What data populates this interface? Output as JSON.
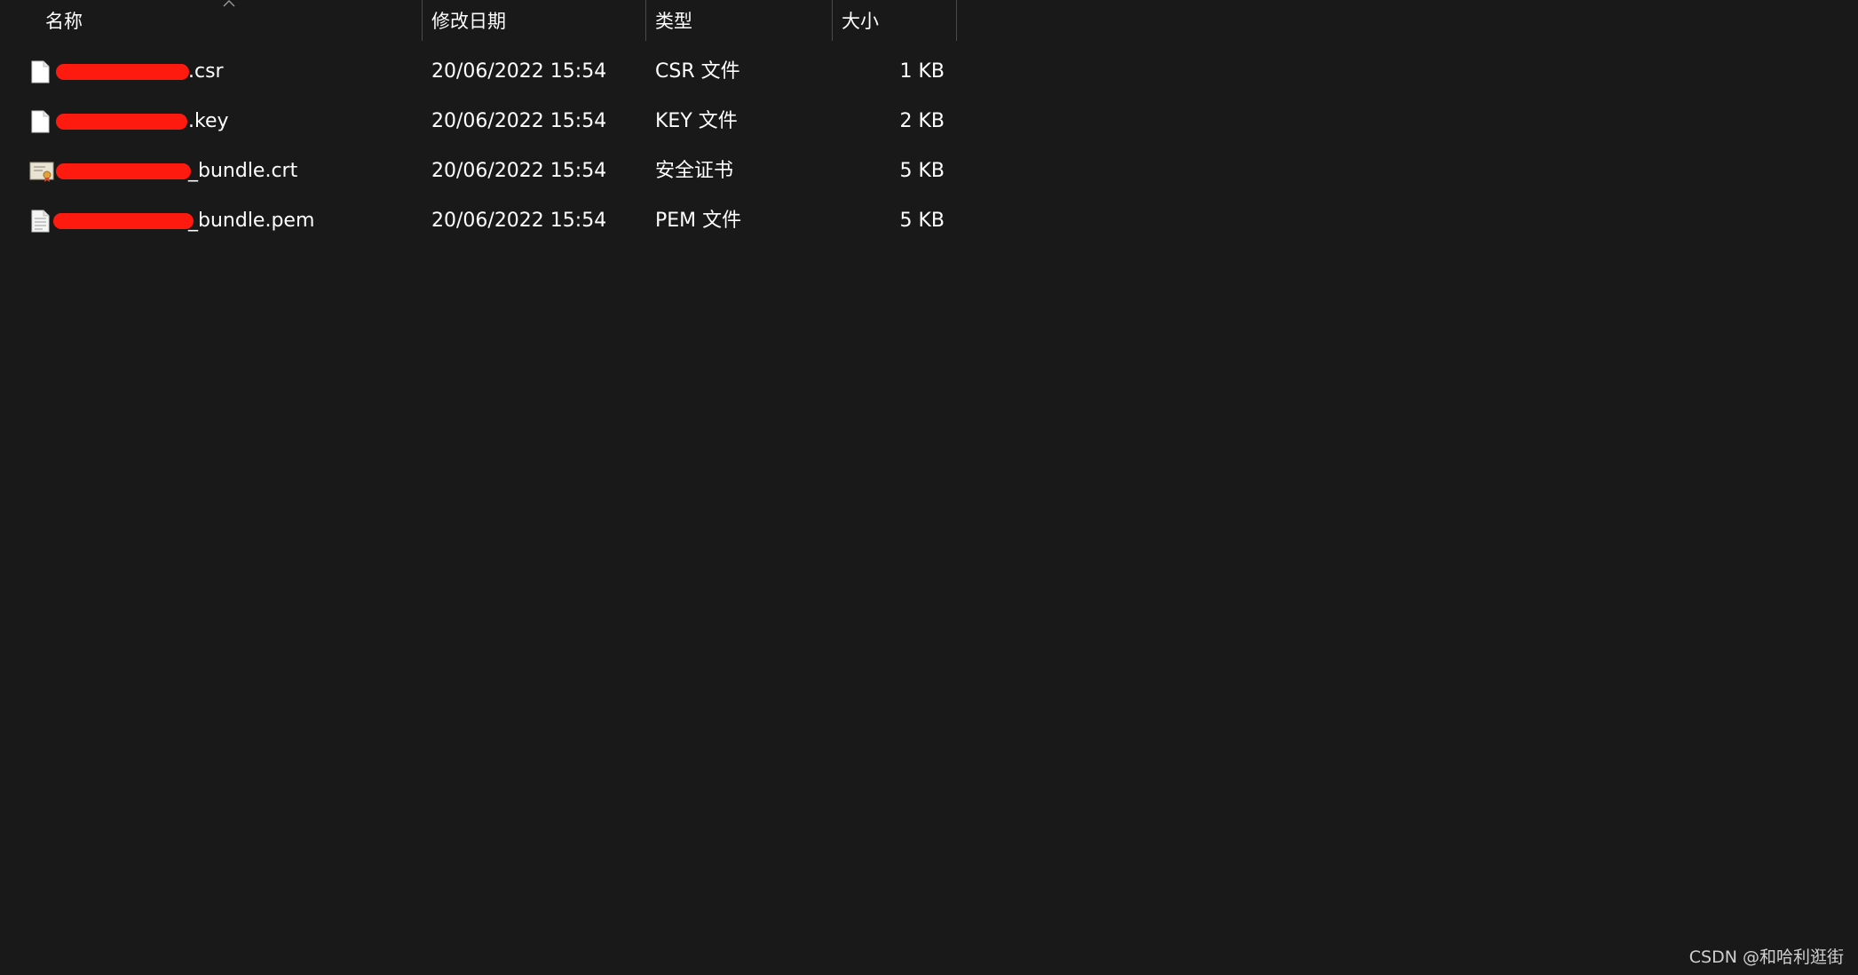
{
  "columns": {
    "name": "名称",
    "date": "修改日期",
    "type": "类型",
    "size": "大小"
  },
  "sort": {
    "column": "name",
    "icon": "chevron-up-icon"
  },
  "files": [
    {
      "name_suffix": ".csr",
      "date": "20/06/2022 15:54",
      "type": "CSR 文件",
      "size": "1 KB",
      "icon": "blank-file-icon"
    },
    {
      "name_suffix": ".key",
      "date": "20/06/2022 15:54",
      "type": "KEY 文件",
      "size": "2 KB",
      "icon": "blank-file-icon"
    },
    {
      "name_suffix": "_bundle.crt",
      "date": "20/06/2022 15:54",
      "type": "安全证书",
      "size": "5 KB",
      "icon": "certificate-icon"
    },
    {
      "name_suffix": "_bundle.pem",
      "date": "20/06/2022 15:54",
      "type": "PEM 文件",
      "size": "5 KB",
      "icon": "text-file-icon"
    }
  ],
  "watermark": "CSDN @和哈利逛街",
  "colors": {
    "background": "#191919",
    "text": "#ffffff",
    "redaction": "#ff1a0f",
    "divider": "#4a4a4a"
  }
}
